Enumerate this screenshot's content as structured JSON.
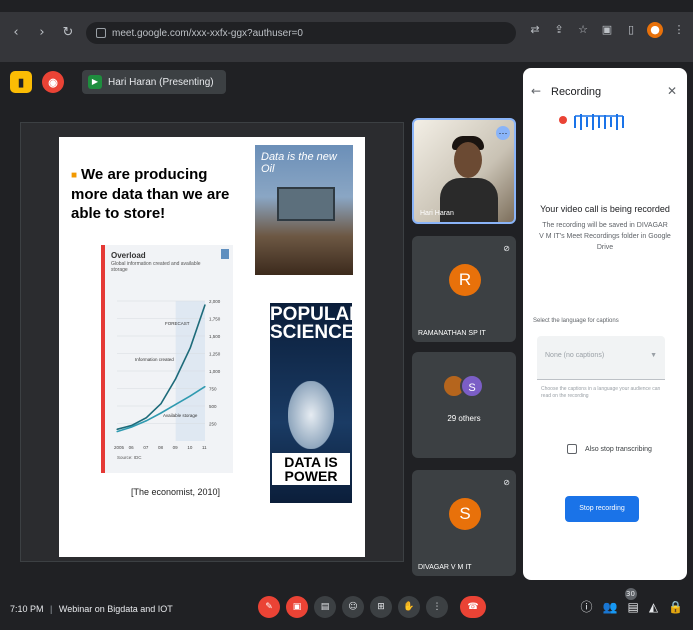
{
  "browser": {
    "url": "meet.google.com/xxx-xxfx-ggx?authuser=0",
    "icons": [
      "back-icon",
      "forward-icon",
      "reload-icon",
      "lock-icon",
      "translate-icon",
      "share-icon",
      "star-icon",
      "extensions-icon",
      "sidepanel-icon",
      "profile-icon",
      "menu-icon"
    ]
  },
  "meet": {
    "presenter_label": "Hari Haran (Presenting)",
    "slide": {
      "bullet": "We are producing more data than we are able to store!",
      "magazine1_title": "Data is the new Oil",
      "magazine2_title": "POPULAR SCIENCE",
      "magazine2_tagline": "DATA IS POWER",
      "caption": "[The economist, 2010]"
    },
    "tiles": [
      {
        "name": "Hari Haran"
      },
      {
        "name": "RAMANATHAN SP IT",
        "initial": "R",
        "color": "#e8710a"
      },
      {
        "name": "29 others",
        "initial": "S",
        "color": "#7b5ec6"
      },
      {
        "name": "DIVAGAR V M IT",
        "initial": "S",
        "color": "#e8710a"
      }
    ],
    "panel": {
      "header": "Recording",
      "title": "Your video call is being recorded",
      "description": "The recording will be saved in DIVAGAR V M IT's Meet Recordings folder in Google Drive",
      "language_label": "Select the language for captions",
      "language_placeholder": "None (no captions)",
      "help_text": "Choose the captions in a language your audience can read on the recording",
      "checkbox_label": "Also stop transcribing",
      "stop_button": "Stop recording"
    },
    "bottom": {
      "time": "7:10 PM",
      "separator": "|",
      "meeting_title": "Webinar on Bigdata and IOT",
      "participants_badge": "30"
    }
  },
  "chart_data": {
    "type": "line",
    "title": "Overload",
    "subtitle": "Global information created and available storage",
    "x": [
      "2005",
      "06",
      "07",
      "08",
      "09",
      "10",
      "11"
    ],
    "series": [
      {
        "name": "Information created",
        "values": [
          150,
          200,
          300,
          480,
          800,
          1200,
          1750
        ]
      },
      {
        "name": "Available storage",
        "values": [
          120,
          180,
          260,
          360,
          470,
          580,
          700
        ]
      }
    ],
    "ylim": [
      0,
      1800
    ],
    "yticks": [
      "250",
      "500",
      "750",
      "1,000",
      "1,250",
      "1,500",
      "1,750",
      "2,000"
    ],
    "annotations": [
      "FORECAST",
      "Information created",
      "Available storage"
    ],
    "source": "Source: IDC"
  }
}
